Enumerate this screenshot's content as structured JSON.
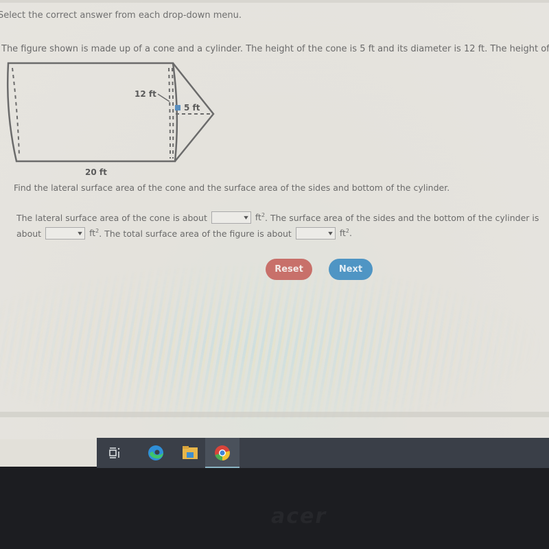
{
  "question": {
    "instruction": "Select the correct answer from each drop-down menu.",
    "prompt": "The figure shown is made up of a cone and a cylinder. The height of the cone is 5 ft and its diameter is 12 ft. The height of t",
    "task": "Find the lateral surface area of the cone and the surface area of the sides and bottom of the cylinder."
  },
  "figure": {
    "diameter_label": "12 ft",
    "cone_height_label": "5 ft",
    "cylinder_length_label": "20 ft"
  },
  "answer": {
    "line1_part1": "The lateral surface area of the cone is about",
    "unit": "ft",
    "unit_exp": "2",
    "line1_part2": ". The surface area of the sides and the bottom of the cylinder is",
    "line2_part1": "about",
    "line2_part2": ". The total surface area of the figure is about",
    "line2_end": ".",
    "dropdowns": [
      {
        "name": "cone-lateral-area",
        "selected": ""
      },
      {
        "name": "cylinder-area",
        "selected": ""
      },
      {
        "name": "total-area",
        "selected": ""
      }
    ],
    "chevron": "▾"
  },
  "buttons": {
    "reset": "Reset",
    "next": "Next"
  },
  "colors": {
    "reset": "#c8706a",
    "next": "#4f95c4"
  },
  "taskbar": {
    "icons": [
      "task-view-icon",
      "edge-icon",
      "file-explorer-icon",
      "chrome-icon"
    ],
    "active": "chrome-icon"
  },
  "bezel": {
    "brand": "acer"
  }
}
